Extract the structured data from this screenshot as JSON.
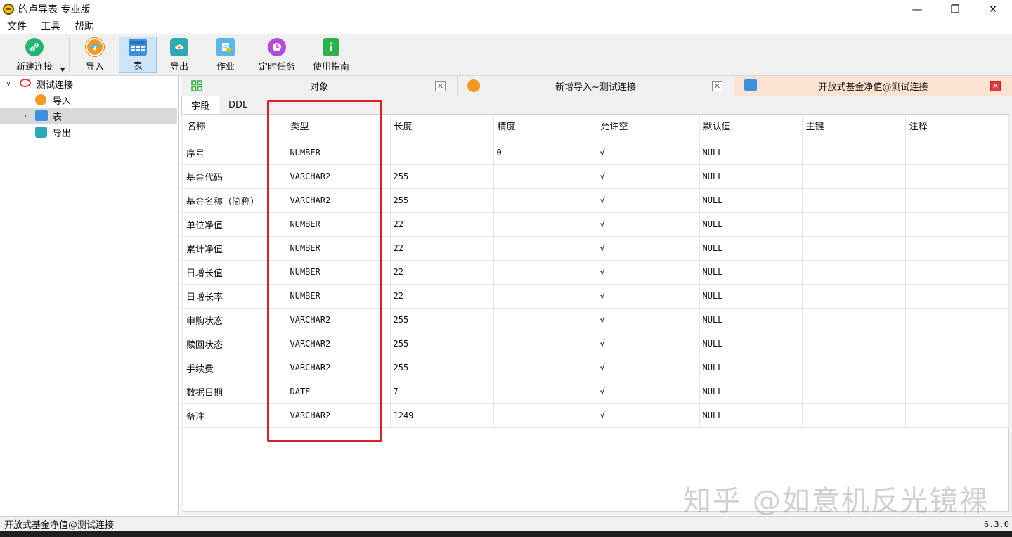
{
  "window": {
    "title": "的卢导表 专业版",
    "minimize": "—",
    "maximize": "❐",
    "close": "✕"
  },
  "menu": [
    "文件",
    "工具",
    "帮助"
  ],
  "toolbar": {
    "new_connection": "新建连接",
    "import": "导入",
    "table": "表",
    "export": "导出",
    "job": "作业",
    "schedule": "定时任务",
    "guide": "使用指南"
  },
  "tree": {
    "connection": "测试连接",
    "items": [
      "导入",
      "表",
      "导出"
    ]
  },
  "tabs": [
    {
      "label": "对象"
    },
    {
      "label": "新增导入~测试连接"
    },
    {
      "label": "开放式基金净值@测试连接"
    }
  ],
  "subtabs": [
    "字段",
    "DDL"
  ],
  "grid": {
    "columns": [
      "名称",
      "类型",
      "长度",
      "精度",
      "允许空",
      "默认值",
      "主键",
      "注释"
    ],
    "rows": [
      [
        "序号",
        "NUMBER",
        "",
        "0",
        "√",
        "NULL",
        "",
        ""
      ],
      [
        "基金代码",
        "VARCHAR2",
        "255",
        "",
        "√",
        "NULL",
        "",
        ""
      ],
      [
        "基金名称（简称）",
        "VARCHAR2",
        "255",
        "",
        "√",
        "NULL",
        "",
        ""
      ],
      [
        "单位净值",
        "NUMBER",
        "22",
        "",
        "√",
        "NULL",
        "",
        ""
      ],
      [
        "累计净值",
        "NUMBER",
        "22",
        "",
        "√",
        "NULL",
        "",
        ""
      ],
      [
        "日增长值",
        "NUMBER",
        "22",
        "",
        "√",
        "NULL",
        "",
        ""
      ],
      [
        "日增长率",
        "NUMBER",
        "22",
        "",
        "√",
        "NULL",
        "",
        ""
      ],
      [
        "申购状态",
        "VARCHAR2",
        "255",
        "",
        "√",
        "NULL",
        "",
        ""
      ],
      [
        "赎回状态",
        "VARCHAR2",
        "255",
        "",
        "√",
        "NULL",
        "",
        ""
      ],
      [
        "手续费",
        "VARCHAR2",
        "255",
        "",
        "√",
        "NULL",
        "",
        ""
      ],
      [
        "数据日期",
        "DATE",
        "7",
        "",
        "√",
        "NULL",
        "",
        ""
      ],
      [
        "备注",
        "VARCHAR2",
        "1249",
        "",
        "√",
        "NULL",
        "",
        ""
      ]
    ]
  },
  "status": {
    "left": "开放式基金净值@测试连接",
    "version": "6.3.0"
  },
  "watermark": "知乎 @如意机反光镜裸",
  "colors": {
    "highlight": "#e02020",
    "active_tab": "#fbe3d2",
    "toolbar_active": "#cde6f7"
  }
}
